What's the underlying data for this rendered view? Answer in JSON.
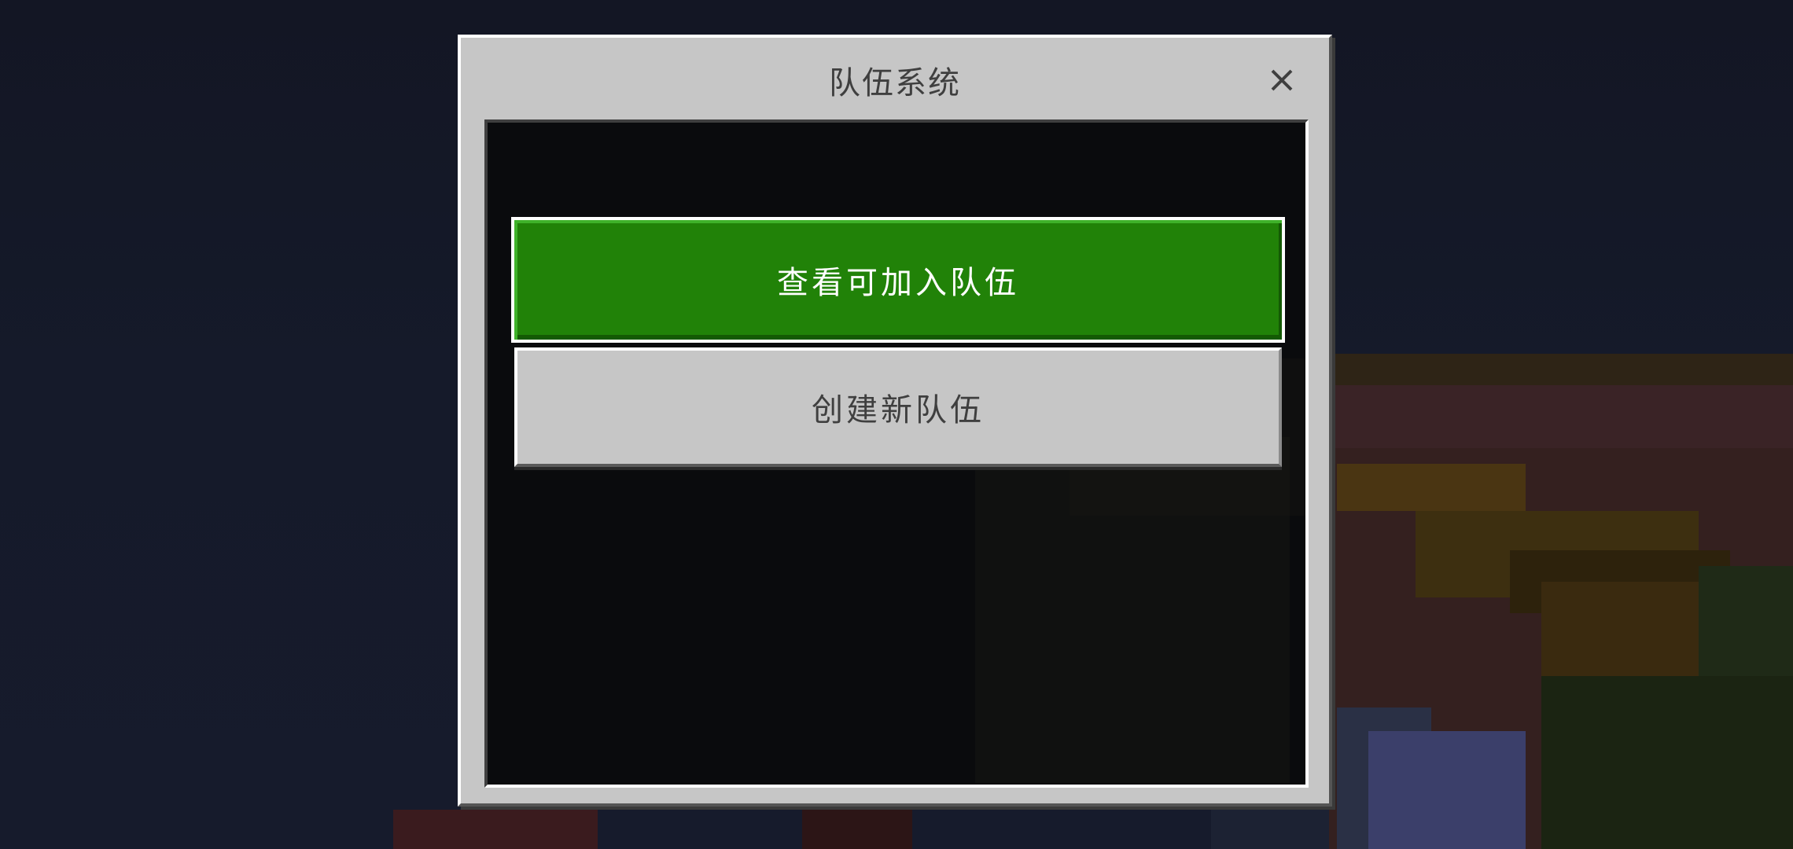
{
  "dialog": {
    "title": "队伍系统",
    "close_icon": "close-icon"
  },
  "buttons": {
    "primary_label": "查看可加入队伍",
    "secondary_label": "创建新队伍"
  },
  "colors": {
    "primary_button": "#218208",
    "secondary_button": "#c6c6c6",
    "panel_background": "#0a0b0d",
    "dialog_background": "#c6c6c6"
  }
}
